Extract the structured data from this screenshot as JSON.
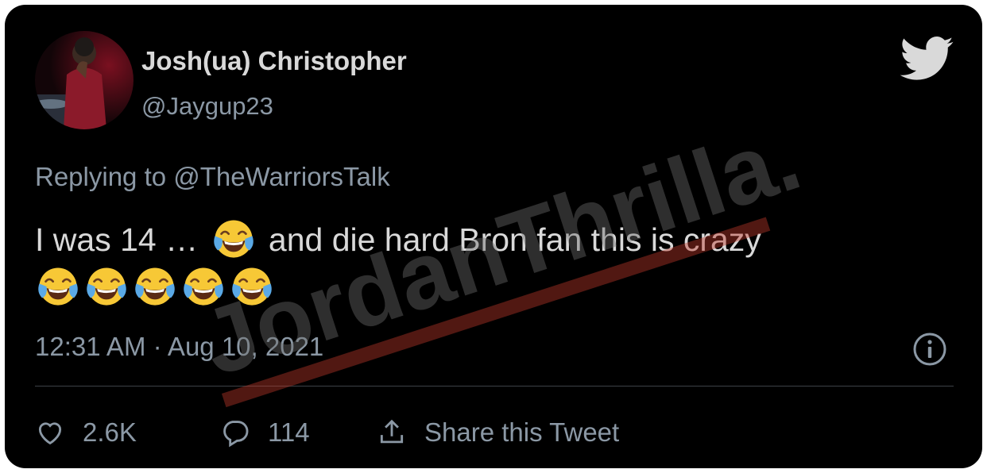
{
  "tweet": {
    "author_name": "Josh(ua) Christopher",
    "author_handle": "@Jaygup23",
    "replying_to": "Replying to @TheWarriorsTalk",
    "text_line1": "I was 14 …",
    "text_line1_rest": "and die hard Bron fan this is crazy",
    "emoji": "face-with-tears-of-joy",
    "emoji_row_count": 5,
    "timestamp": "12:31 AM · Aug 10, 2021"
  },
  "actions": {
    "likes": "2.6K",
    "replies": "114",
    "share_label": "Share this Tweet"
  },
  "watermark": {
    "text": "JordanThrilla."
  },
  "colors": {
    "background": "#000000",
    "primary_text": "#d9d9d9",
    "secondary_text": "#8b98a5",
    "twitter_bird": "#d9d9d9",
    "watermark_red": "#c0392b"
  }
}
